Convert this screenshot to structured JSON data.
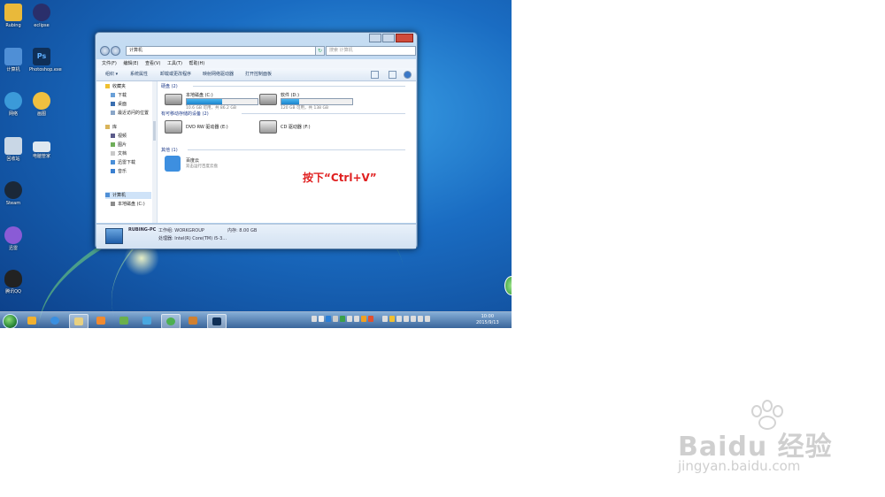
{
  "desktop": {
    "icons": [
      {
        "label": "Rubing",
        "icon": "folder-icon",
        "color": "#e9b93a"
      },
      {
        "label": "eclipse",
        "icon": "eclipse-icon",
        "color": "#2a2f6b"
      },
      {
        "label": "计算机",
        "icon": "computer-icon",
        "color": "#4f8fd6"
      },
      {
        "label": "Photoshop.exe",
        "icon": "photoshop-icon",
        "color": "#0f2f57"
      },
      {
        "label": "网络",
        "icon": "network-icon",
        "color": "#3b9ad9"
      },
      {
        "label": "画图",
        "icon": "paint-icon",
        "color": "#f0c040"
      },
      {
        "label": "回收站",
        "icon": "recycle-bin-icon",
        "color": "#c9d7e6"
      },
      {
        "label": "电脑管家",
        "icon": "window-icon",
        "color": "#dfe8f0"
      },
      {
        "label": "Steam",
        "icon": "steam-icon",
        "color": "#1b2838"
      },
      {
        "label": "迅雷",
        "icon": "disc-icon",
        "color": "#8a5bd6"
      },
      {
        "label": "腾讯QQ",
        "icon": "qq-penguin-icon",
        "color": "#222222"
      }
    ]
  },
  "explorer": {
    "address": "计算机",
    "search_placeholder": "搜索 计算机",
    "menu": [
      "文件(F)",
      "编辑(E)",
      "查看(V)",
      "工具(T)",
      "帮助(H)"
    ],
    "toolbar": [
      "组织 ▾",
      "系统属性",
      "卸载或更改程序",
      "映射网络驱动器",
      "打开控制面板"
    ],
    "nav": {
      "favorites": "收藏夹",
      "fav_items": [
        "下载",
        "桌面",
        "最近访问的位置"
      ],
      "libraries": "库",
      "lib_items": [
        "视频",
        "图片",
        "文档",
        "迅雷下载",
        "音乐"
      ],
      "computer": "计算机",
      "comp_items": [
        "本地磁盘 (C:)"
      ]
    },
    "groups": {
      "hdd": "硬盘 (2)",
      "removable": "有可移动存储的设备 (2)",
      "other": "其他 (1)"
    },
    "drives": [
      {
        "name": "本地磁盘 (C:)",
        "free": "10.6 GB 可用，共 86.2 GB",
        "used_fraction": 0.5
      },
      {
        "name": "软件 (D:)",
        "free": "120 GB 可用，共 138 GB",
        "used_fraction": 0.25
      }
    ],
    "devices": [
      {
        "name": "DVD RW 驱动器 (E:)"
      },
      {
        "name": "CD 驱动器 (F:)"
      }
    ],
    "other_item": {
      "name": "百度云",
      "desc": "双击运行百度云盘"
    },
    "status": {
      "name": "RUBING-PC",
      "workgroup": "工作组: WORKGROUP",
      "memory": "内存: 8.00 GB",
      "cpu": "处理器: Intel(R) Core(TM) i5-3..."
    }
  },
  "instruction": "按下“Ctrl+V”",
  "taskbar": {
    "clock_time": "10:00",
    "clock_date": "2015/9/13",
    "apps": [
      "folder-icon",
      "media-icon",
      "ie-icon",
      "explorer-icon",
      "media-player-icon",
      "tool-icon",
      "plane-icon",
      "chrome-icon",
      "brush-icon",
      "photoshop-icon"
    ]
  },
  "watermark": {
    "brand": "Baidu 经验",
    "url": "jingyan.baidu.com"
  }
}
